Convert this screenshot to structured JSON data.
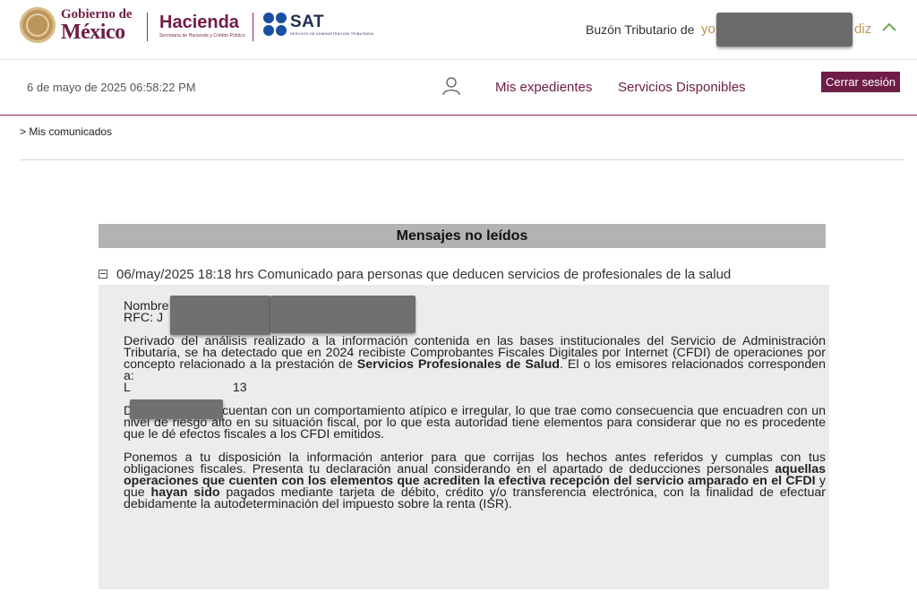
{
  "header": {
    "gob_line1": "Gobierno de",
    "gob_line2": "México",
    "hacienda_title": "Hacienda",
    "hacienda_sub": "Secretaría de Hacienda y Crédito Público",
    "sat_title": "SAT",
    "sat_sub": "SERVICIO DE ADMINISTRACIÓN TRIBUTARIA",
    "buzon_label": "Buzón Tributario de",
    "user_prefix": "yo",
    "user_suffix": "diz"
  },
  "nav": {
    "datetime": "6 de mayo de 2025 06:58:22 PM",
    "links": [
      "Mis expedientes",
      "Servicios Disponibles"
    ],
    "logout": "Cerrar sesión"
  },
  "breadcrumb": "> Mis comunicados",
  "messages": {
    "section_title": "Mensajes no leídos",
    "item_title": "06/may/2025 18:18 hrs Comunicado para personas que deducen servicios de profesionales de la salud",
    "nombre_label": "Nombre",
    "rfc_label": "RFC: J",
    "p1_a": "Derivado del análisis realizado a la información contenida en las bases institucionales del Servicio de Administración Tributaria, se ha detectado que en 2024 recibiste Comprobantes Fiscales Digitales por Internet (CFDI) de operaciones por concepto relacionado a la prestación de ",
    "p1_bold": "Servicios Profesionales de Salud",
    "p1_b": ". El o los emisores relacionados corresponden a:",
    "emisor_prefix": "L",
    "emisor_suffix": "13",
    "p2": "Dichos emisores cuentan con un comportamiento atípico e irregular, lo que trae como consecuencia que encuadren con un nivel de riesgo alto en su situación fiscal, por lo que esta autoridad tiene elementos para considerar que no es procedente que le dé efectos fiscales a los CFDI emitidos.",
    "p3_a": "Ponemos a tu disposición la información anterior para que corrijas los hechos antes referidos y cumplas con tus obligaciones fiscales. Presenta tu declaración anual considerando en el apartado de deducciones personales ",
    "p3_bold1": "aquellas operaciones que cuenten con los elementos que acrediten la efectiva recepción del servicio amparado en el CFDI",
    "p3_b": " y que ",
    "p3_bold2": "hayan sido",
    "p3_c": " pagados mediante tarjeta de débito, crédito y/o transferencia electrónica, con la finalidad de efectuar debidamente la autodeterminación del impuesto sobre la renta (ISR)."
  },
  "colors": {
    "guinda": "#6f1d46",
    "gold": "#bc955c",
    "sat_blue": "#1a4fa3",
    "header_gray": "#b3b3b3",
    "body_gray": "#ececec"
  },
  "icons": [
    "gob-mexico-seal-icon",
    "sat-logo-icon",
    "chevron-up-icon",
    "user-icon",
    "collapse-minus-icon"
  ]
}
